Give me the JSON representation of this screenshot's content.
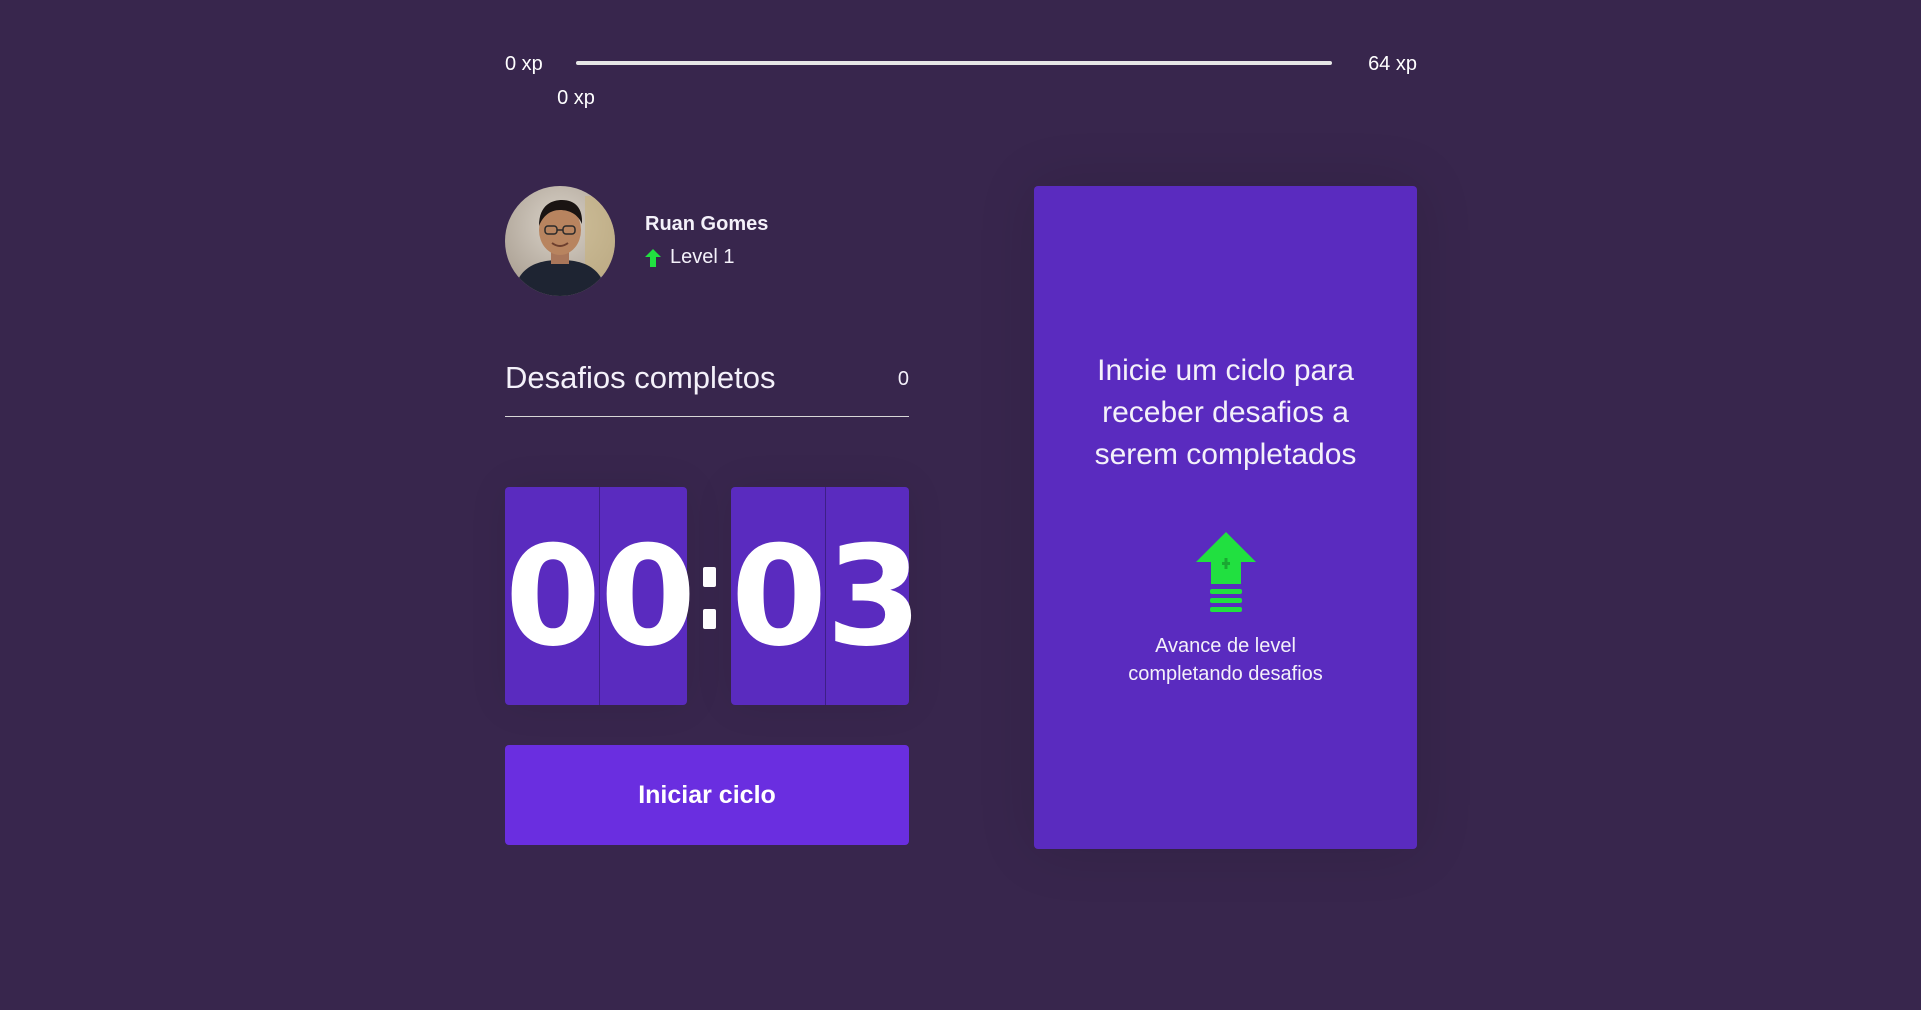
{
  "xp": {
    "min_label": "0 xp",
    "max_label": "64 xp",
    "current_label": "0 xp",
    "current_fraction": 0
  },
  "profile": {
    "name": "Ruan Gomes",
    "level_label": "Level 1",
    "level_icon": "level-up-arrow-icon"
  },
  "challenges": {
    "label": "Desafios completos",
    "count": "0"
  },
  "countdown": {
    "minute_left": "0",
    "minute_right": "0",
    "second_left": "0",
    "second_right": "3"
  },
  "actions": {
    "start_label": "Iniciar ciclo"
  },
  "card": {
    "title": "Inicie um ciclo para receber desafios a serem completados",
    "hint_line1": "Avance de level",
    "hint_line2": "completando desafios",
    "icon": "level-up-icon"
  },
  "colors": {
    "background": "#38264d",
    "card": "#5a2bbf",
    "button": "#6a2ee0",
    "accent_green": "#21e040"
  }
}
